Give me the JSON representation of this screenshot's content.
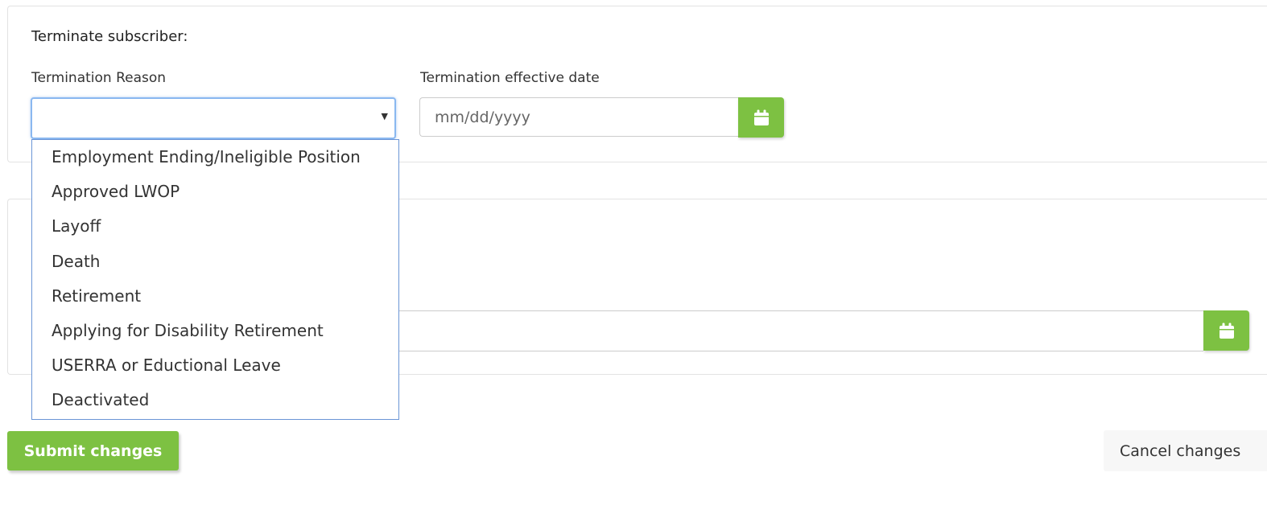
{
  "form": {
    "heading": "Terminate subscriber:",
    "reason_label": "Termination Reason",
    "reason_selected": "",
    "date_label": "Termination effective date",
    "date_placeholder": "mm/dd/yyyy",
    "date_value": ""
  },
  "dropdown": {
    "options": [
      "Employment Ending/Ineligible Position",
      "Approved LWOP",
      "Layoff",
      "Death",
      "Retirement",
      "Applying for Disability Retirement",
      "USERRA or Eductional Leave",
      "Deactivated"
    ]
  },
  "actions": {
    "submit_label": "Submit changes",
    "cancel_label": "Cancel changes"
  },
  "icons": {
    "calendar": "calendar-icon",
    "caret": "caret-down-icon"
  },
  "colors": {
    "accent_green": "#7dc142",
    "focus_blue": "#8ab8f0",
    "dropdown_border": "#6b95d6"
  }
}
